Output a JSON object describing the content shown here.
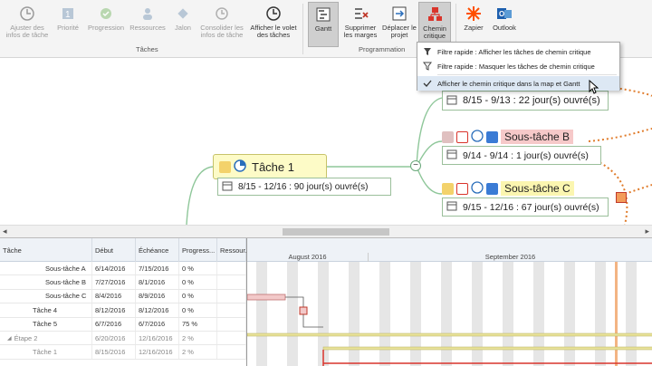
{
  "ribbon": {
    "buttons": [
      {
        "label": "Ajuster des infos de tâche",
        "icon": "clock-plus-icon"
      },
      {
        "label": "Priorité",
        "icon": "priority-icon"
      },
      {
        "label": "Progression",
        "icon": "progress-icon"
      },
      {
        "label": "Ressources",
        "icon": "resources-icon"
      },
      {
        "label": "Jalon",
        "icon": "milestone-icon"
      },
      {
        "label": "Consolider les infos de tâche",
        "icon": "consolidate-icon"
      },
      {
        "label": "Afficher le volet des tâches",
        "icon": "task-pane-icon"
      },
      {
        "label": "Gantt",
        "icon": "gantt-icon"
      },
      {
        "label": "Supprimer les marges",
        "icon": "remove-margins-icon"
      },
      {
        "label": "Déplacer le projet",
        "icon": "move-project-icon"
      },
      {
        "label": "Chemin critique",
        "icon": "critical-path-icon"
      },
      {
        "label": "Zapier",
        "icon": "zapier-icon"
      },
      {
        "label": "Outlook",
        "icon": "outlook-icon"
      }
    ],
    "groups": {
      "taches": "Tâches",
      "programmation": "Programmation"
    }
  },
  "dropdown": {
    "items": [
      "Filtre rapide : Afficher les tâches de chemin critique",
      "Filtre rapide : Masquer les tâches de chemin critique",
      "Afficher le chemin critique dans la map et Gantt"
    ]
  },
  "map": {
    "main_task": {
      "title": "Tâche 1",
      "dates": "8/15 - 12/16 : 90 jour(s) ouvré(s)"
    },
    "top_node": "8/15 - 9/13 : 22 jour(s) ouvré(s)",
    "sub_b": {
      "title": "Sous-tâche B",
      "dates": "9/14 - 9/14 : 1 jour(s) ouvré(s)"
    },
    "sub_c": {
      "title": "Sous-tâche C",
      "dates": "9/15 - 12/16 : 67 jour(s) ouvré(s)"
    },
    "collapse_symbol": "−"
  },
  "gantt": {
    "headers": [
      "Tâche",
      "Début",
      "Échéance",
      "Progress...",
      "Ressour..."
    ],
    "rows": [
      {
        "task": "Sous-tâche A",
        "start": "6/14/2016",
        "end": "7/15/2016",
        "progress": "0 %",
        "indent": 3,
        "gray": false
      },
      {
        "task": "Sous-tâche B",
        "start": "7/27/2016",
        "end": "8/1/2016",
        "progress": "0 %",
        "indent": 3,
        "gray": false
      },
      {
        "task": "Sous-tâche C",
        "start": "8/4/2016",
        "end": "8/9/2016",
        "progress": "0 %",
        "indent": 3,
        "gray": false
      },
      {
        "task": "Tâche 4",
        "start": "8/12/2016",
        "end": "8/12/2016",
        "progress": "0 %",
        "indent": 2,
        "gray": false
      },
      {
        "task": "Tâche 5",
        "start": "6/7/2016",
        "end": "6/7/2016",
        "progress": "75 %",
        "indent": 2,
        "gray": false
      },
      {
        "task": "Étape 2",
        "start": "6/20/2016",
        "end": "12/16/2016",
        "progress": "2 %",
        "indent": 1,
        "gray": true
      },
      {
        "task": "Tâche 1",
        "start": "8/15/2016",
        "end": "12/16/2016",
        "progress": "2 %",
        "indent": 2,
        "gray": true
      }
    ],
    "months": [
      "August 2016",
      "September 2016"
    ]
  }
}
